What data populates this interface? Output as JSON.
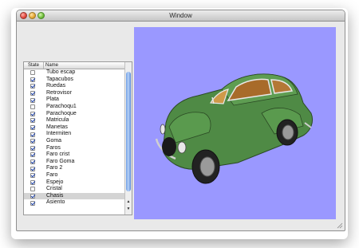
{
  "window": {
    "title": "Window"
  },
  "table": {
    "headers": {
      "state": "State",
      "name": "Name"
    },
    "rows": [
      {
        "name": "Tubo escap",
        "checked": false,
        "selected": false
      },
      {
        "name": "Tapacubos",
        "checked": true,
        "selected": false
      },
      {
        "name": "Ruedas",
        "checked": true,
        "selected": false
      },
      {
        "name": "Retrovisor",
        "checked": true,
        "selected": false
      },
      {
        "name": "Plata",
        "checked": true,
        "selected": false
      },
      {
        "name": "Parachoqu1",
        "checked": false,
        "selected": false
      },
      {
        "name": "Parachoque",
        "checked": true,
        "selected": false
      },
      {
        "name": "Matricula",
        "checked": true,
        "selected": false
      },
      {
        "name": "Manetas",
        "checked": true,
        "selected": false
      },
      {
        "name": "Intermiten",
        "checked": true,
        "selected": false
      },
      {
        "name": "Goma",
        "checked": true,
        "selected": false
      },
      {
        "name": "Faros",
        "checked": true,
        "selected": false
      },
      {
        "name": "Faro crist",
        "checked": true,
        "selected": false
      },
      {
        "name": "Faro Goma",
        "checked": true,
        "selected": false
      },
      {
        "name": "Faro 2",
        "checked": true,
        "selected": false
      },
      {
        "name": "Faro",
        "checked": true,
        "selected": false
      },
      {
        "name": "Espejo",
        "checked": true,
        "selected": false
      },
      {
        "name": "Cristal",
        "checked": false,
        "selected": false
      },
      {
        "name": "Chasis",
        "checked": true,
        "selected": true
      },
      {
        "name": "Asiento",
        "checked": true,
        "selected": false
      }
    ]
  },
  "viewport": {
    "background": "#9a98ff",
    "car_color": "#4f8a45"
  }
}
